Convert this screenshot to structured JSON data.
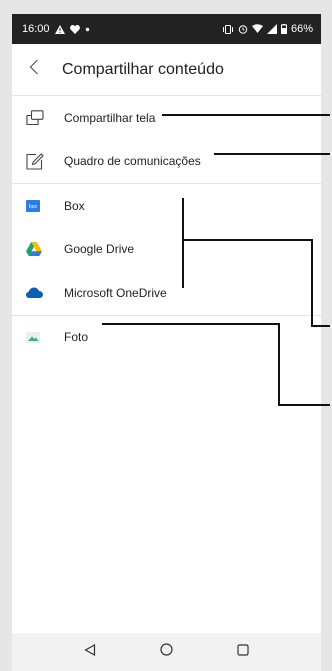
{
  "status_bar": {
    "time": "16:00",
    "battery": "66%"
  },
  "header": {
    "title": "Compartilhar conteúdo"
  },
  "share_items": [
    {
      "label": "Compartilhar tela",
      "icon": "share-screen-icon"
    },
    {
      "label": "Quadro de comunicações",
      "icon": "whiteboard-icon"
    }
  ],
  "storage_items": [
    {
      "label": "Box",
      "icon": "box-icon"
    },
    {
      "label": "Google Drive",
      "icon": "google-drive-icon"
    },
    {
      "label": "Microsoft OneDrive",
      "icon": "onedrive-icon"
    }
  ],
  "photo_items": [
    {
      "label": "Foto",
      "icon": "photo-icon"
    }
  ],
  "colors": {
    "status_bar": "#222222",
    "box_blue": "#2d7ee0",
    "onedrive_blue": "#0b5fb5",
    "photo_teal": "#4aa88c",
    "drive_green": "#1ea362",
    "drive_yellow": "#f7bc0b",
    "drive_blue": "#2f79e8"
  }
}
